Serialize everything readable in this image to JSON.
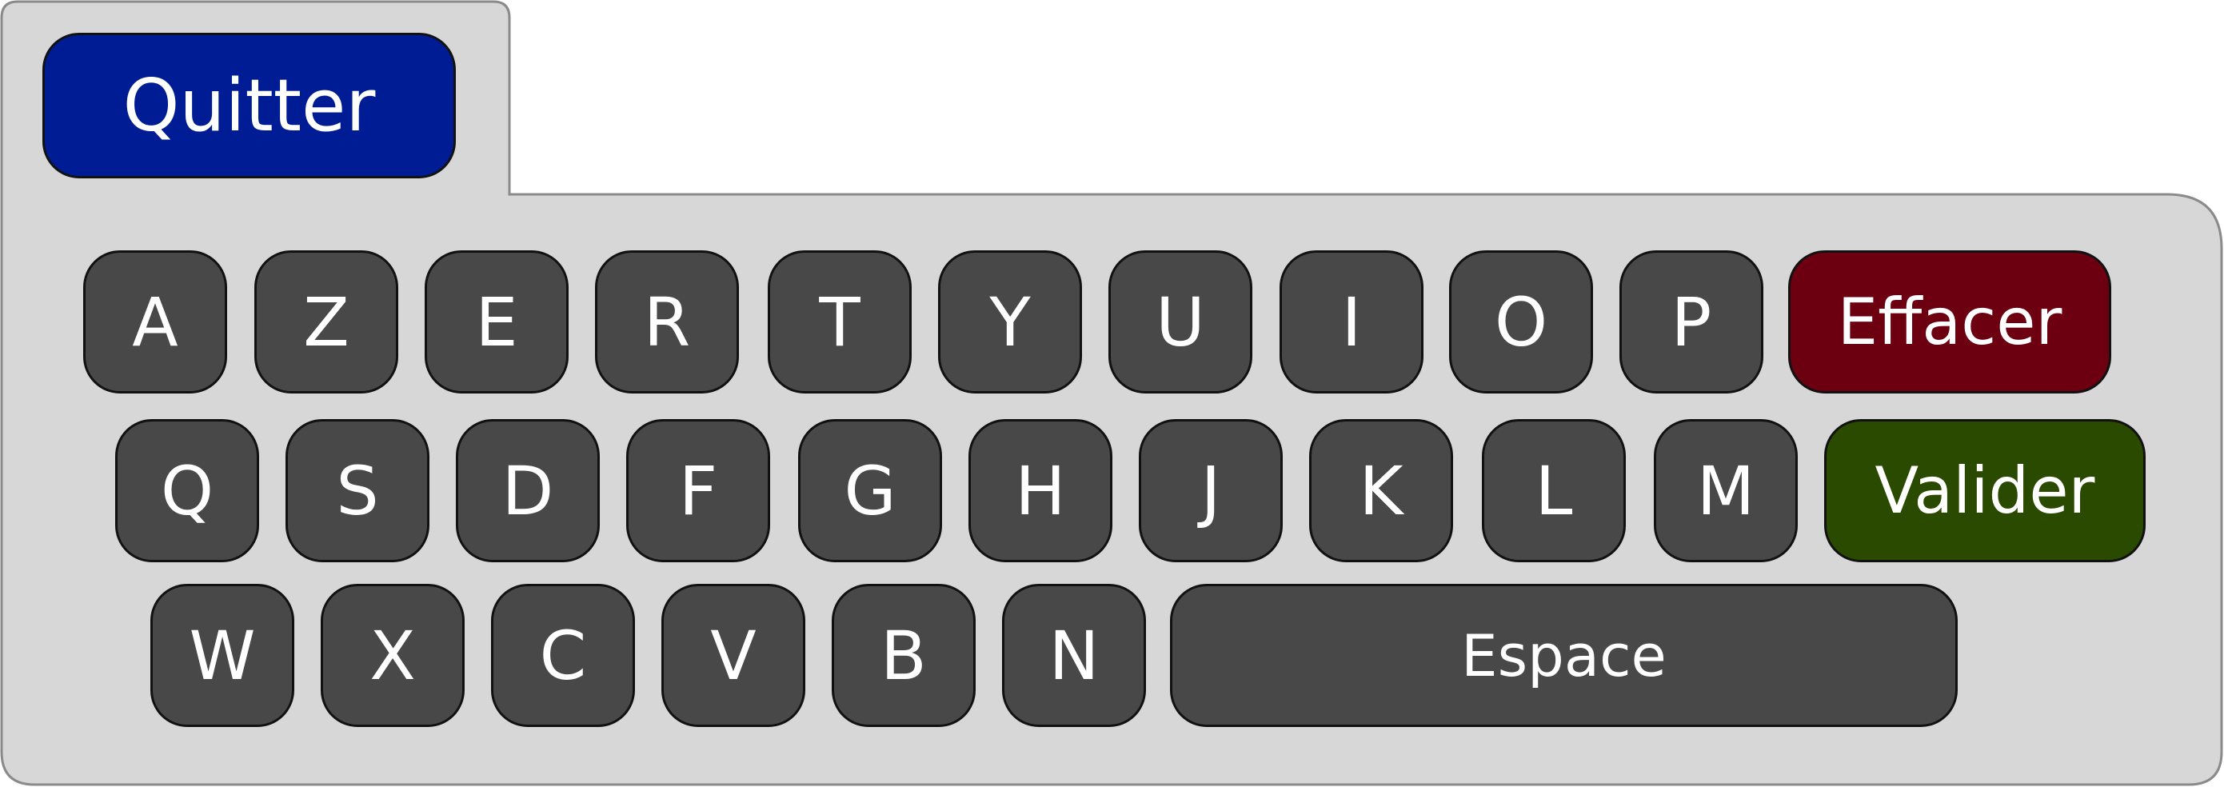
{
  "colors": {
    "panel_background": "#d7d7d7",
    "key_background": "#484848",
    "quit_button": "#001c94",
    "erase_button": "#6c0010",
    "validate_button": "#2a4a00",
    "key_text": "#ffffff"
  },
  "buttons": {
    "quit": "Quitter",
    "erase": "Effacer",
    "validate": "Valider",
    "space": "Espace"
  },
  "rows": [
    [
      "A",
      "Z",
      "E",
      "R",
      "T",
      "Y",
      "U",
      "I",
      "O",
      "P"
    ],
    [
      "Q",
      "S",
      "D",
      "F",
      "G",
      "H",
      "J",
      "K",
      "L",
      "M"
    ],
    [
      "W",
      "X",
      "C",
      "V",
      "B",
      "N"
    ]
  ]
}
